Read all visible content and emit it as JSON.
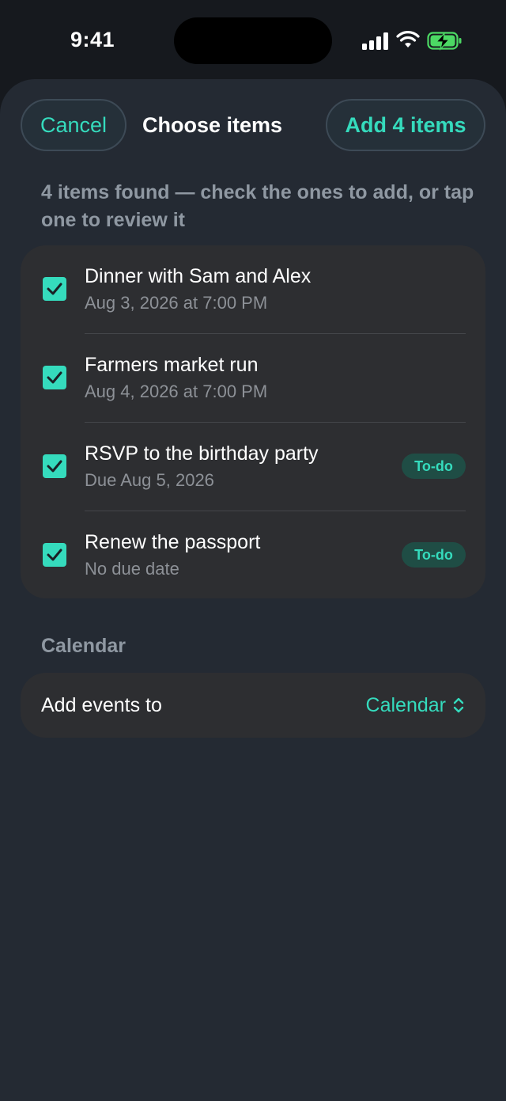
{
  "status_bar": {
    "time": "9:41",
    "icons": [
      "signal-icon",
      "wifi-icon",
      "battery-charging-icon"
    ]
  },
  "sheet": {
    "cancel_label": "Cancel",
    "title": "Choose items",
    "add_label": "Add 4 items",
    "hint": "4 items found — check the ones to add, or tap one to review it"
  },
  "items": [
    {
      "title": "Dinner with Sam and Alex",
      "subtitle": "Aug 3, 2026 at 7:00 PM",
      "checked": true,
      "badge": ""
    },
    {
      "title": "Farmers market run",
      "subtitle": "Aug 4, 2026 at 7:00 PM",
      "checked": true,
      "badge": ""
    },
    {
      "title": "RSVP to the birthday party",
      "subtitle": "Due Aug 5, 2026",
      "checked": true,
      "badge": "To-do"
    },
    {
      "title": "Renew the passport",
      "subtitle": "No due date",
      "checked": true,
      "badge": "To-do"
    }
  ],
  "calendar_section": {
    "heading": "Calendar",
    "row_label": "Add events to",
    "selected_calendar": "Calendar"
  },
  "colors": {
    "accent": "#35dbbd",
    "sheet_background": "#242a33",
    "card_background": "#2d2e31",
    "badge_background": "#1f4d45",
    "secondary_text": "#8f98a2"
  }
}
